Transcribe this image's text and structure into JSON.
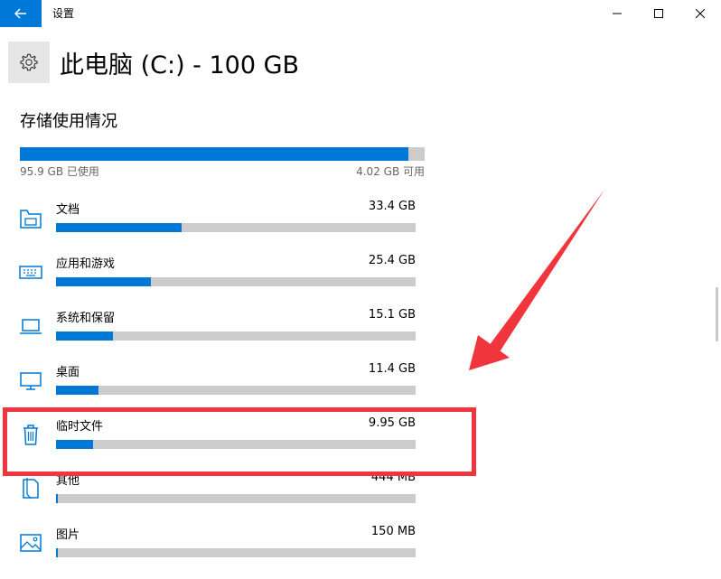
{
  "window": {
    "title": "设置",
    "back_icon": "back-arrow-icon",
    "controls": [
      "minimize-icon",
      "maximize-icon",
      "close-icon"
    ]
  },
  "page": {
    "title": "此电脑 (C:) - 100 GB",
    "icon": "gear-icon",
    "section_title": "存储使用情况"
  },
  "storage": {
    "used_label": "95.9 GB 已使用",
    "available_label": "4.02 GB 可用",
    "used_fraction": 0.959
  },
  "categories": [
    {
      "name": "文档",
      "size": "33.4 GB",
      "fraction": 0.35,
      "icon": "documents-icon"
    },
    {
      "name": "应用和游戏",
      "size": "25.4 GB",
      "fraction": 0.265,
      "icon": "keyboard-icon"
    },
    {
      "name": "系统和保留",
      "size": "15.1 GB",
      "fraction": 0.158,
      "icon": "laptop-icon"
    },
    {
      "name": "桌面",
      "size": "11.4 GB",
      "fraction": 0.119,
      "icon": "monitor-icon"
    },
    {
      "name": "临时文件",
      "size": "9.95 GB",
      "fraction": 0.104,
      "icon": "trash-icon"
    },
    {
      "name": "其他",
      "size": "444 MB",
      "fraction": 0.005,
      "icon": "other-files-icon"
    },
    {
      "name": "图片",
      "size": "150 MB",
      "fraction": 0.002,
      "icon": "pictures-icon"
    }
  ],
  "colors": {
    "accent": "#0078d7",
    "bar_track": "#cccccc",
    "annotation": "#f0353d"
  }
}
